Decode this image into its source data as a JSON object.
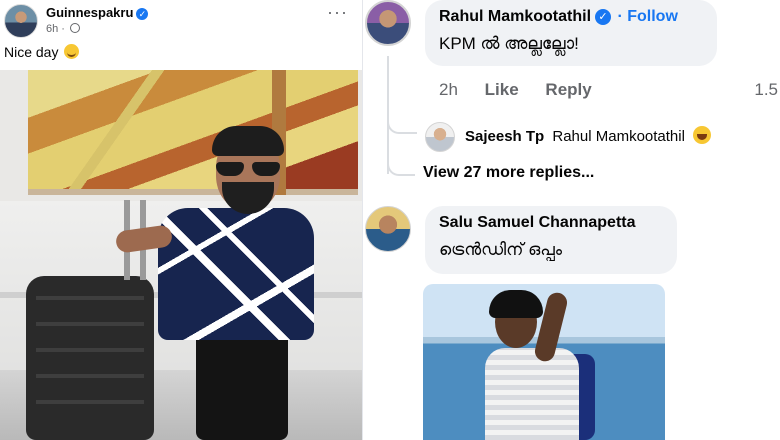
{
  "post": {
    "author": "Guinnespakru",
    "time": "6h",
    "more_label": "···",
    "text": "Nice day"
  },
  "comments": [
    {
      "author": "Rahul Mamkootathil",
      "follow_label": "· Follow",
      "text": "KPM ൽ അല്ലല്ലോ!",
      "time": "2h",
      "like_label": "Like",
      "reply_label": "Reply",
      "reaction_count": "1.5"
    },
    {
      "author": "Salu Samuel Channapetta",
      "text": "ട്രെൻഡിന് ഒപ്പം"
    }
  ],
  "reply": {
    "author": "Sajeesh Tp",
    "tag": "Rahul Mamkootathil"
  },
  "view_more_replies": "View 27 more replies...",
  "colors": {
    "link": "#1877f2",
    "bubble": "#f0f2f5",
    "muted": "#65676b"
  },
  "icons": [
    "verified-icon",
    "globe-icon",
    "more-icon",
    "smile-emoji-icon",
    "laugh-emoji-icon"
  ]
}
